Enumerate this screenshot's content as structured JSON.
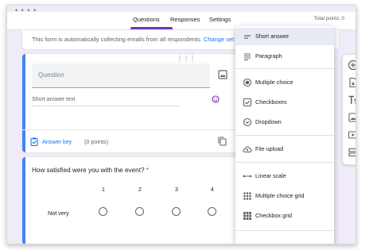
{
  "header": {
    "tabs": [
      {
        "label": "Questions",
        "active": true
      },
      {
        "label": "Responses",
        "active": false
      },
      {
        "label": "Settings",
        "active": false
      }
    ],
    "total_points": "Total points: 0"
  },
  "notice": {
    "text": "This form is automatically collecting emails from all respondents.",
    "link": "Change set"
  },
  "question1": {
    "placeholder": "Question",
    "answer_hint": "Short answer text",
    "answer_key": "Answer key",
    "points": "(0 points)"
  },
  "question2": {
    "title": "How satisfied were you with the event?",
    "required_mark": "*",
    "scale": [
      "1",
      "2",
      "3",
      "4"
    ],
    "row_label": "Not very"
  },
  "type_menu": {
    "items": [
      {
        "label": "Short answer",
        "icon": "short-answer-icon",
        "selected": true
      },
      {
        "label": "Paragraph",
        "icon": "paragraph-icon"
      },
      {
        "label": "Multiple choice",
        "icon": "radio-icon"
      },
      {
        "label": "Checkboxes",
        "icon": "checkbox-icon"
      },
      {
        "label": "Dropdown",
        "icon": "dropdown-icon"
      },
      {
        "label": "File upload",
        "icon": "cloud-upload-icon"
      },
      {
        "label": "Linear scale",
        "icon": "linear-scale-icon"
      },
      {
        "label": "Multiple choice grid",
        "icon": "grid-icon"
      },
      {
        "label": "Checkbox grid",
        "icon": "checkbox-grid-icon"
      }
    ]
  },
  "side_toolbar": [
    "add-question-icon",
    "import-questions-icon",
    "add-title-icon",
    "add-image-icon",
    "add-video-icon",
    "add-section-icon"
  ],
  "colors": {
    "accent": "#673ab7",
    "link": "#1a73e8",
    "question_bar": "#4285f4",
    "background": "#f0ebf8",
    "selected_item": "#e8eaf6"
  }
}
